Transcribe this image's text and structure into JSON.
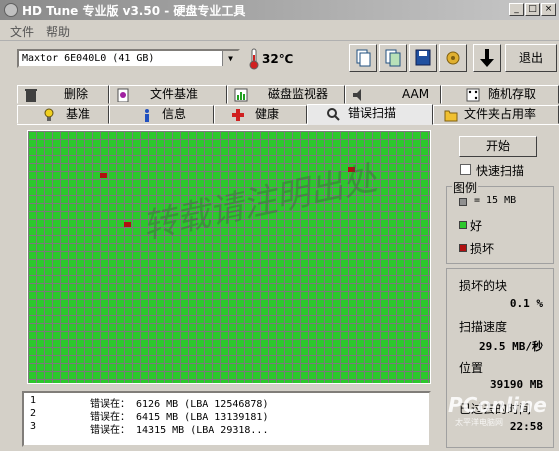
{
  "window": {
    "title": "HD Tune 专业版 v3.50 - 硬盘专业工具"
  },
  "menu": [
    "文件",
    "帮助"
  ],
  "drive": {
    "selected": "Maxtor 6E040L0 (41 GB)",
    "temperature": "32℃"
  },
  "toolbar": {
    "exit_label": "退出"
  },
  "tabs_row1": [
    "删除",
    "文件基准",
    "磁盘监视器",
    "AAM",
    "随机存取"
  ],
  "tabs_row2": [
    "基准",
    "信息",
    "健康",
    "错误扫描",
    "文件夹占用率"
  ],
  "scan": {
    "start_label": "开始",
    "quick_scan_label": "快速扫描",
    "quick_scan_checked": false
  },
  "legend": {
    "title": "图例",
    "block_size": "= 15 MB",
    "good": "好",
    "bad": "损坏"
  },
  "stats": {
    "damaged_label": "损坏的块",
    "damaged_value": "0.1 %",
    "speed_label": "扫描速度",
    "speed_value": "29.5 MB/秒",
    "position_label": "位置",
    "position_value": "39190 MB",
    "elapsed_label": "已过去的时间",
    "elapsed_value": "22:58"
  },
  "errors": [
    {
      "index": "1",
      "text": "错误在： 6126 MB (LBA 12546878)"
    },
    {
      "index": "2",
      "text": "错误在： 6415 MB (LBA 13139181)"
    },
    {
      "index": "3",
      "text": "错误在： 14315 MB (LBA 29318..."
    }
  ],
  "watermark": {
    "pcon": "PConline",
    "pcon_sub": "太平洋电脑网"
  },
  "colors": {
    "good": "#2cc82c",
    "bad": "#b01010",
    "block_grid": "#7a7a7a"
  }
}
